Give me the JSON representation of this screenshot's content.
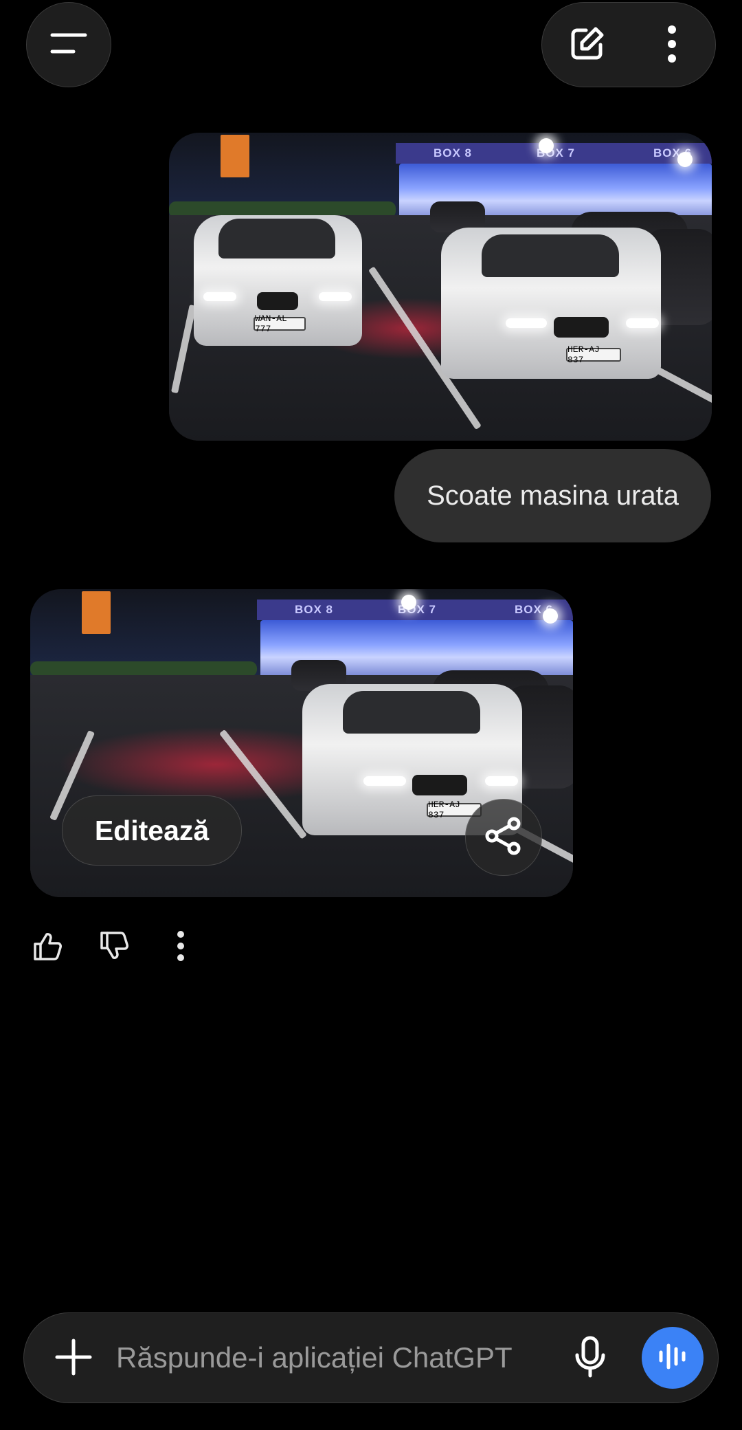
{
  "header": {
    "menu_icon": "menu-icon",
    "new_chat_icon": "edit-icon",
    "more_icon": "more-vertical-icon"
  },
  "conversation": {
    "user_message": {
      "image_alt": "Night photo of two white BMW cars in a parking lot",
      "plate_left": "WAN-AL 777",
      "plate_right": "HER-AJ 837",
      "text": "Scoate masina urata"
    },
    "assistant_message": {
      "image_alt": "Edited photo with one white BMW remaining",
      "plate": "HER-AJ 837",
      "edit_label": "Editează",
      "share_icon": "share-icon",
      "actions": [
        "thumbs-up-icon",
        "thumbs-down-icon",
        "more-vertical-icon"
      ]
    }
  },
  "composer": {
    "placeholder": "Răspunde-i aplicației ChatGPT",
    "add_icon": "plus-icon",
    "mic_icon": "mic-icon",
    "voice_icon": "voice-mode-icon",
    "accent_color": "#3b82f6"
  }
}
